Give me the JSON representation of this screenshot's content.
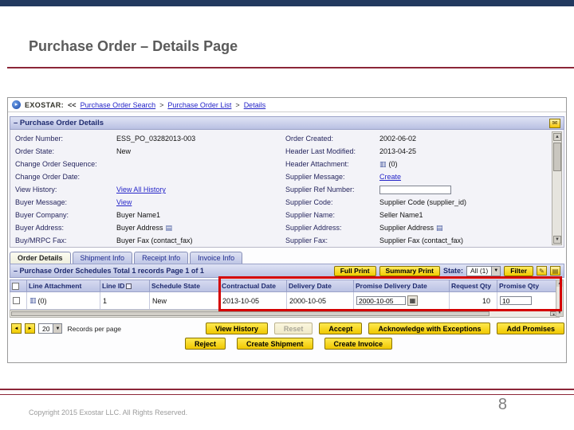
{
  "slide": {
    "title": "Purchase Order – Details Page",
    "footer": "Copyright 2015 Exostar LLC. All Rights Reserved.",
    "page_number": "8"
  },
  "app": {
    "breadcrumb": {
      "brand": "EXOSTAR:",
      "back": "<<",
      "separator": ">",
      "crumbs": [
        "Purchase Order Search",
        "Purchase Order List",
        "Details"
      ]
    },
    "details": {
      "title": "– Purchase Order Details",
      "left": [
        {
          "label": "Order Number:",
          "value": "ESS_PO_03282013-003"
        },
        {
          "label": "Order State:",
          "value": "New"
        },
        {
          "label": "Change Order Sequence:",
          "value": ""
        },
        {
          "label": "Change Order Date:",
          "value": ""
        },
        {
          "label": "View History:",
          "value": "View All History"
        },
        {
          "label": "Buyer Message:",
          "value": "View"
        },
        {
          "label": "Buyer Company:",
          "value": "Buyer Name1"
        },
        {
          "label": "Buyer Address:",
          "value": "Buyer Address"
        },
        {
          "label": "Buy/MRPC Fax:",
          "value": "Buyer Fax (contact_fax)"
        }
      ],
      "right": [
        {
          "label": "Order Created:",
          "value": "2002-06-02"
        },
        {
          "label": "Header Last Modified:",
          "value": "2013-04-25"
        },
        {
          "label": "Header Attachment:",
          "value": "(0)"
        },
        {
          "label": "Supplier Message:",
          "value": "Create"
        },
        {
          "label": "Supplier Ref Number:",
          "value": ""
        },
        {
          "label": "Supplier Code:",
          "value": "Supplier Code (supplier_id)"
        },
        {
          "label": "Supplier Name:",
          "value": "Seller Name1"
        },
        {
          "label": "Supplier Address:",
          "value": "Supplier Address"
        },
        {
          "label": "Supplier Fax:",
          "value": "Supplier Fax (contact_fax)"
        }
      ]
    },
    "tabs": [
      {
        "label": "Order Details"
      },
      {
        "label": "Shipment Info"
      },
      {
        "label": "Receipt Info"
      },
      {
        "label": "Invoice Info"
      }
    ],
    "schedules": {
      "title": "– Purchase Order Schedules Total 1 records Page 1 of 1",
      "full_print": "Full Print",
      "summary_print": "Summary Print",
      "state_label": "State:",
      "state_value": "All (1)",
      "filter": "Filter"
    },
    "table": {
      "headers": [
        "Line Attachment",
        "Line ID",
        "Schedule State",
        "Contractual Date",
        "Delivery Date",
        "Promise Delivery Date",
        "Request Qty",
        "Promise Qty"
      ],
      "row": {
        "line_attachment": "(0)",
        "line_id": "1",
        "schedule_state": "New",
        "contractual_date": "2013-10-05",
        "delivery_date": "2000-10-05",
        "promise_delivery_date": "2000-10-05",
        "request_qty": "10",
        "promise_qty": "10"
      }
    },
    "pagination": {
      "page_size": "20",
      "records_label": "Records per page"
    },
    "actions": {
      "view_history": "View History",
      "reset": "Reset",
      "accept": "Accept",
      "acknowledge": "Acknowledge with Exceptions",
      "add_promises": "Add Promises",
      "reject": "Reject",
      "create_shipment": "Create Shipment",
      "create_invoice": "Create Invoice"
    }
  },
  "colors": {
    "slide_accent_maroon": "#8C2638",
    "top_bar_navy": "#22395F",
    "header_lavender": "#BFC6E6",
    "button_yellow": "#F2CC00",
    "highlight_red": "#D40000",
    "link_blue": "#2525C8"
  }
}
